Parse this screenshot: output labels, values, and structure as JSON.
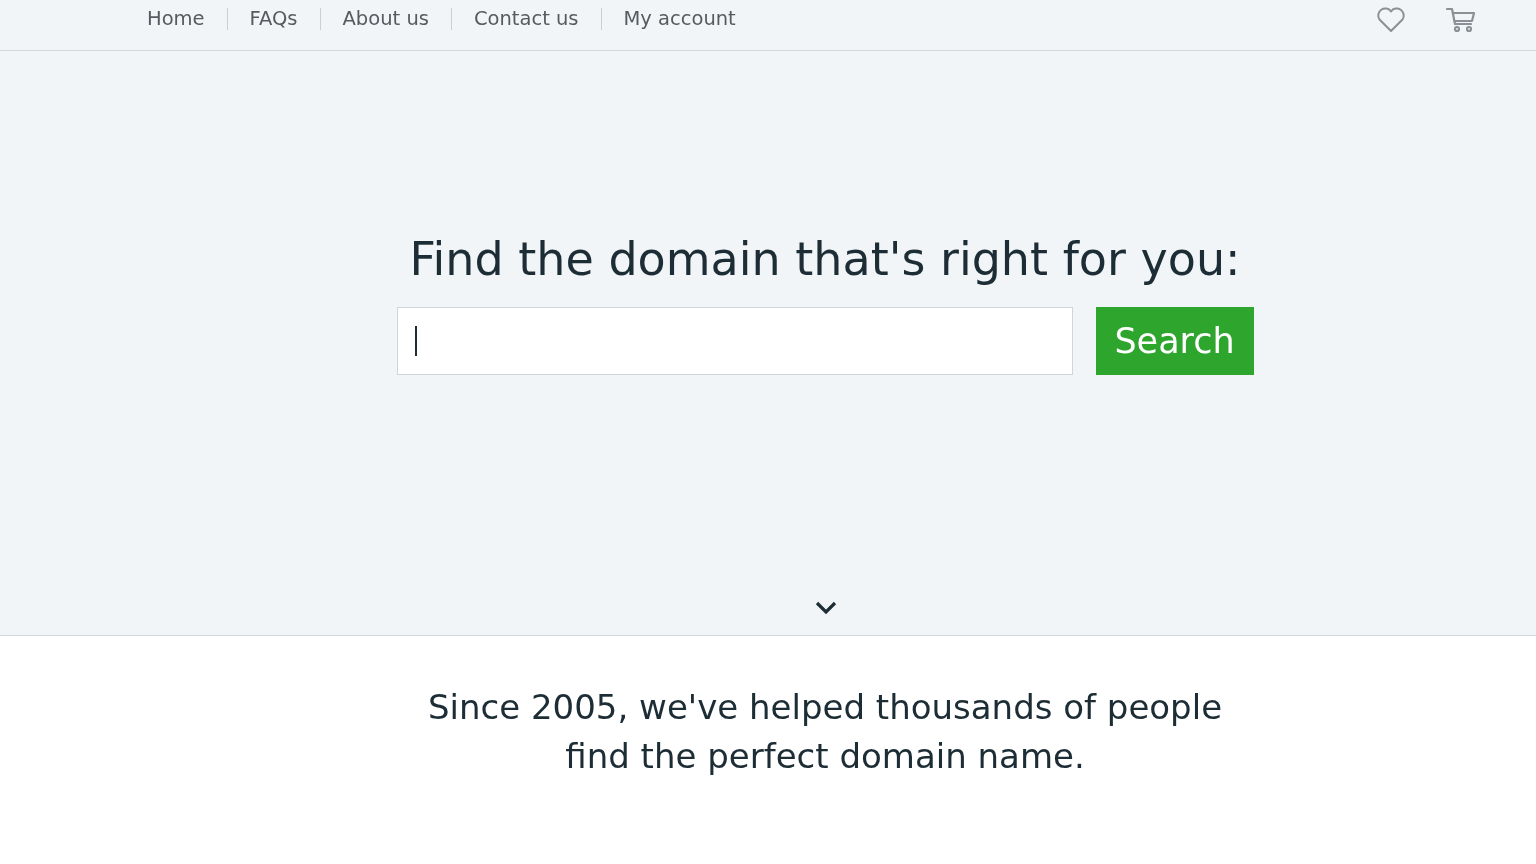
{
  "nav": {
    "links": [
      {
        "label": "Home"
      },
      {
        "label": "FAQs"
      },
      {
        "label": "About us"
      },
      {
        "label": "Contact us"
      },
      {
        "label": "My account"
      }
    ]
  },
  "hero": {
    "title": "Find the domain that's right for you:",
    "search": {
      "focused": true,
      "button": "Search"
    }
  },
  "intro": {
    "text": "Since 2005, we've helped thousands of people find the perfect domain name."
  }
}
